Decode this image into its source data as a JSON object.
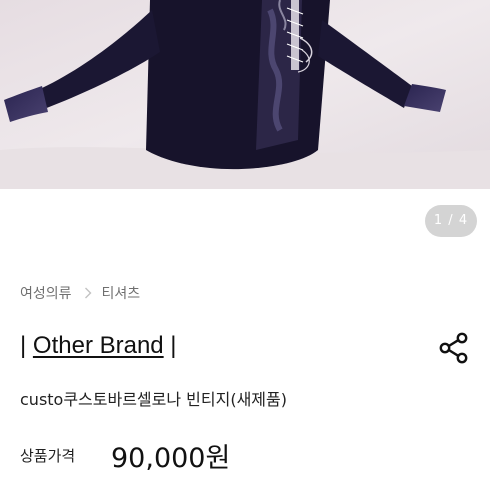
{
  "gallery": {
    "counter": "1 / 4"
  },
  "breadcrumb": {
    "items": [
      "여성의류",
      "티셔츠"
    ]
  },
  "product": {
    "brand_prefix": "| ",
    "brand": "Other Brand",
    "brand_suffix": " |",
    "title": "custo쿠스토바르셀로나 빈티지(새제품)",
    "price_label": "상품가격",
    "price": "90,000원"
  },
  "icons": {
    "share": "share-icon",
    "breadcrumb_separator": "chevron-right-icon"
  },
  "colors": {
    "counter_bg": "#d4d4d4",
    "garment": "#1a1530"
  }
}
